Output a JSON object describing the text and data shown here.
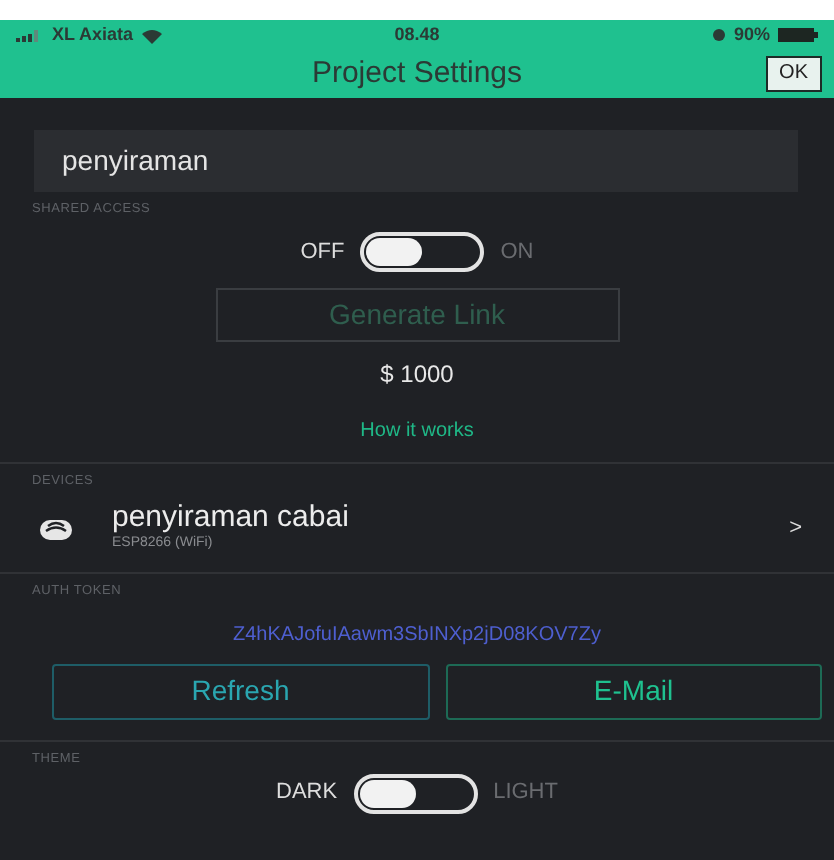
{
  "status_bar": {
    "carrier": "XL Axiata",
    "time": "08.48",
    "battery": "90%"
  },
  "header": {
    "title": "Project Settings",
    "ok_button": "OK"
  },
  "project_name": {
    "value": "penyiraman"
  },
  "shared_access": {
    "label": "SHARED ACCESS",
    "toggle": {
      "off_label": "OFF",
      "on_label": "ON",
      "on": false
    },
    "generate_button": {
      "label": "Generate Link",
      "disabled": true
    },
    "price": "$ 1000",
    "link": "How it works"
  },
  "devices": {
    "label": "DEVICES",
    "items": [
      {
        "name": "penyiraman cabai",
        "model": "ESP8266 (WiFi)",
        "chevron": ">"
      }
    ]
  },
  "auth_token": {
    "label": "AUTH TOKEN",
    "token": "Z4hKAJofuIAawm3SbINXp2jD08KOV7Zy",
    "buttons": [
      {
        "label": "Refresh",
        "kind": "refresh"
      },
      {
        "label": "E-Mail",
        "kind": "email"
      }
    ]
  },
  "theme": {
    "label": "THEME",
    "toggle": {
      "off_label": "DARK",
      "on_label": "LIGHT",
      "on": false
    }
  }
}
